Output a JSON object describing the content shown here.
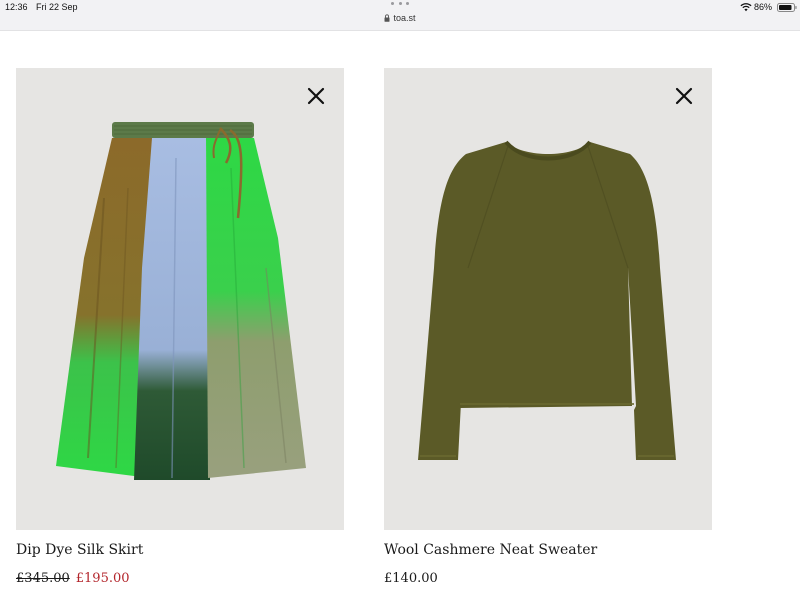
{
  "status_bar": {
    "time": "12:36",
    "date": "Fri 22 Sep",
    "url": "toa.st",
    "battery": "86%"
  },
  "products": [
    {
      "name": "Dip Dye Silk Skirt",
      "price_original": "£345.00",
      "price_sale": "£195.00",
      "image_icon": "skirt-image"
    },
    {
      "name": "Wool Cashmere Neat Sweater",
      "price": "£140.00",
      "image_icon": "sweater-image"
    }
  ],
  "colors": {
    "sale_price": "#b3262c",
    "image_background": "#e6e5e3",
    "sweater": "#5b5a27",
    "skirt_green": "#2fcf45",
    "skirt_blue": "#9fb6de",
    "skirt_ochre": "#8c6a2a"
  }
}
